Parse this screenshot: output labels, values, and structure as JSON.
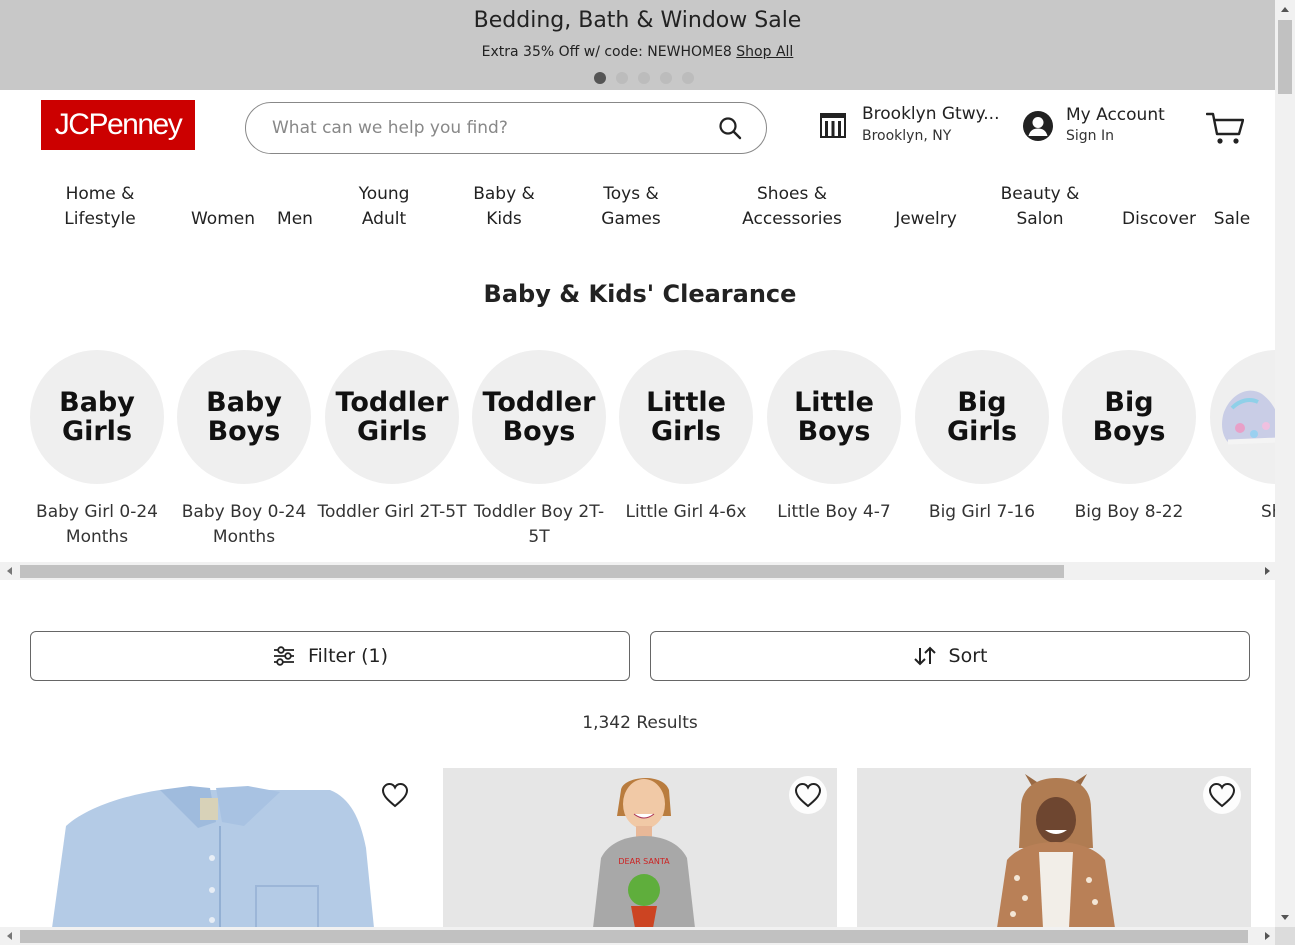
{
  "promo": {
    "title": "Bedding, Bath & Window Sale",
    "subtitle": "Extra 35% Off w/ code: NEWHOME8",
    "link": "Shop All",
    "slides": 5,
    "active_slide": 1
  },
  "header": {
    "logo_text": "JCPenney",
    "search_placeholder": "What can we help you find?",
    "store_name": "Brooklyn Gtwy...",
    "store_location": "Brooklyn, NY",
    "account_title": "My Account",
    "account_sub": "Sign In"
  },
  "nav": {
    "items": [
      {
        "label": "Home &\nLifestyle"
      },
      {
        "label": "Women"
      },
      {
        "label": "Men"
      },
      {
        "label": "Young\nAdult"
      },
      {
        "label": "Baby &\nKids"
      },
      {
        "label": "Toys &\nGames"
      },
      {
        "label": "Shoes &\nAccessories"
      },
      {
        "label": "Jewelry"
      },
      {
        "label": "Beauty &\nSalon"
      },
      {
        "label": "Discover"
      },
      {
        "label": "Sale"
      }
    ]
  },
  "section": {
    "title": "Baby & Kids' Clearance"
  },
  "categories": [
    {
      "circle": "Baby\nGirls",
      "label": "Baby Girl 0-24 Months"
    },
    {
      "circle": "Baby\nBoys",
      "label": "Baby Boy 0-24 Months"
    },
    {
      "circle": "Toddler\nGirls",
      "label": "Toddler Girl 2T-5T"
    },
    {
      "circle": "Toddler\nBoys",
      "label": "Toddler Boy 2T-5T"
    },
    {
      "circle": "Little\nGirls",
      "label": "Little Girl 4-6x"
    },
    {
      "circle": "Little\nBoys",
      "label": "Little Boy 4-7"
    },
    {
      "circle": "Big\nGirls",
      "label": "Big Girl 7-16"
    },
    {
      "circle": "Big\nBoys",
      "label": "Big Boy 8-22"
    },
    {
      "circle": "",
      "label": "Sho"
    }
  ],
  "controls": {
    "filter_label": "Filter (1)",
    "sort_label": "Sort",
    "results": "1,342 Results"
  },
  "products": [
    {
      "name": "product-blue-shirt"
    },
    {
      "name": "product-girl-grinch-top"
    },
    {
      "name": "product-deer-costume"
    }
  ],
  "colors": {
    "brand_red": "#cc0000",
    "promo_bg": "#c8c8c8",
    "circle_bg": "#efefef"
  }
}
